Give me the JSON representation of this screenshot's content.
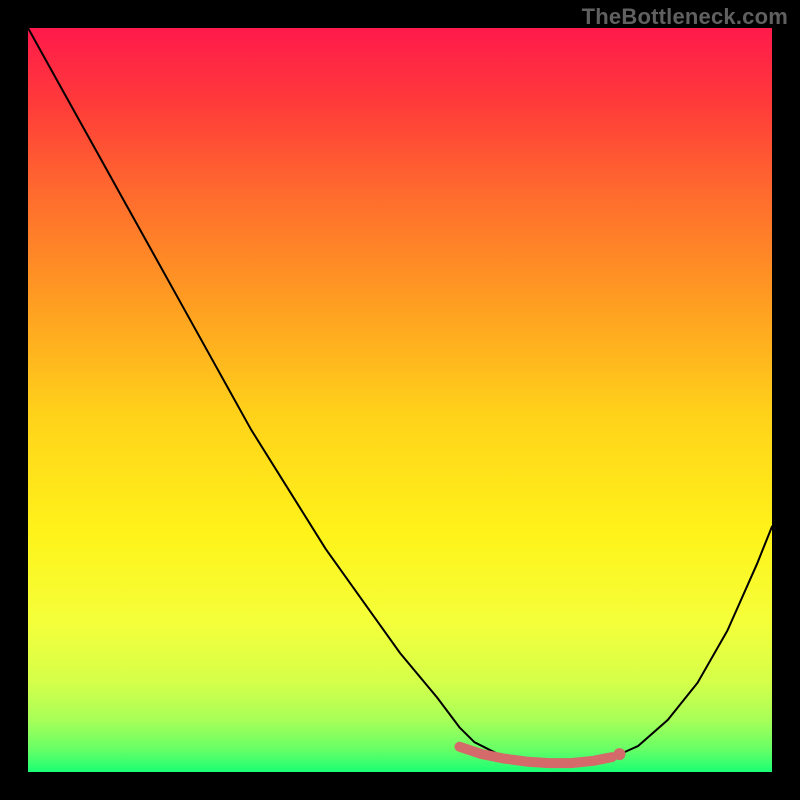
{
  "watermark": "TheBottleneck.com",
  "gradient": {
    "stops": [
      {
        "offset": 0.0,
        "color": "#ff1a4b"
      },
      {
        "offset": 0.1,
        "color": "#ff3a3a"
      },
      {
        "offset": 0.22,
        "color": "#ff6a2e"
      },
      {
        "offset": 0.36,
        "color": "#ff9a22"
      },
      {
        "offset": 0.52,
        "color": "#ffd21a"
      },
      {
        "offset": 0.68,
        "color": "#fff31a"
      },
      {
        "offset": 0.8,
        "color": "#f4ff3a"
      },
      {
        "offset": 0.88,
        "color": "#d4ff4a"
      },
      {
        "offset": 0.93,
        "color": "#a8ff58"
      },
      {
        "offset": 0.97,
        "color": "#66ff66"
      },
      {
        "offset": 1.0,
        "color": "#1aff74"
      }
    ]
  },
  "curve_style": {
    "stroke": "#000000",
    "width": 2
  },
  "marker_style": {
    "color": "#d46a6a",
    "radius": 6,
    "line_width": 10
  },
  "chart_data": {
    "type": "line",
    "title": "",
    "xlabel": "",
    "ylabel": "",
    "xlim": [
      0,
      100
    ],
    "ylim": [
      0,
      100
    ],
    "series": [
      {
        "name": "bottleneck-curve",
        "x": [
          0,
          5,
          10,
          15,
          20,
          25,
          30,
          35,
          40,
          45,
          50,
          55,
          58,
          60,
          63,
          66,
          70,
          74,
          78,
          82,
          86,
          90,
          94,
          98,
          100
        ],
        "values": [
          100,
          91,
          82,
          73,
          64,
          55,
          46,
          38,
          30,
          23,
          16,
          10,
          6,
          4,
          2.5,
          1.6,
          1.1,
          1.1,
          1.7,
          3.5,
          7,
          12,
          19,
          28,
          33
        ]
      }
    ],
    "markers": {
      "name": "optimal-range",
      "x": [
        58,
        61,
        64,
        67,
        70,
        73,
        76,
        78.5
      ],
      "values": [
        3.4,
        2.4,
        1.8,
        1.4,
        1.2,
        1.2,
        1.5,
        2.0
      ]
    },
    "end_dot": {
      "x": 79.5,
      "values": 2.4
    }
  }
}
